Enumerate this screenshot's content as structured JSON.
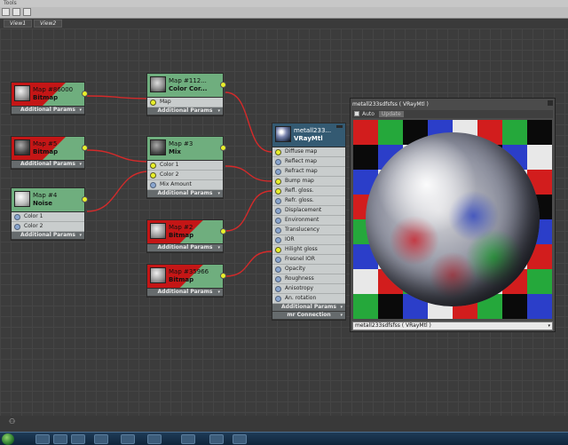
{
  "window": {
    "title": "Tools"
  },
  "tabs": [
    {
      "label": "View1"
    },
    {
      "label": "View2"
    }
  ],
  "nodes": {
    "bitmap1": {
      "title": "Map #86000",
      "subtitle": "Bitmap",
      "additional": "Additional Params"
    },
    "bitmap2": {
      "title": "Map #5",
      "subtitle": "Bitmap",
      "additional": "Additional Params"
    },
    "noise": {
      "title": "Map #4",
      "subtitle": "Noise",
      "ports": [
        "Color 1",
        "Color 2"
      ],
      "additional": "Additional Params"
    },
    "colorcorrect": {
      "title": "Map #112...",
      "subtitle": "Color Cor...",
      "ports": [
        "Map"
      ],
      "additional": "Additional Params"
    },
    "mix": {
      "title": "Map #3",
      "subtitle": "Mix",
      "ports": [
        "Color 1",
        "Color 2",
        "Mix Amount"
      ],
      "additional": "Additional Params"
    },
    "bitmap3": {
      "title": "Map #2",
      "subtitle": "Bitmap",
      "additional": "Additional Params"
    },
    "bitmap4": {
      "title": "Map #35966",
      "subtitle": "Bitmap",
      "additional": "Additional Params"
    },
    "material": {
      "title": "metall233...",
      "subtitle": "VRayMtl",
      "ports": [
        "Diffuse map",
        "Reflect map",
        "Refract map",
        "Bump map",
        "Refl. gloss.",
        "Refr. gloss.",
        "Displacement",
        "Environment",
        "Translucency",
        "IOR",
        "Hilight gloss",
        "Fresnel IOR",
        "Opacity",
        "Roughness",
        "Anisotropy",
        "An. rotation"
      ],
      "connected": [
        true,
        false,
        false,
        true,
        true,
        false,
        false,
        false,
        false,
        false,
        true,
        false,
        false,
        false,
        false,
        false
      ],
      "additional": "Additional Params",
      "connection": "mr Connection"
    }
  },
  "preview": {
    "title": "metall233sdfsfss  ( VRayMtl )",
    "auto_label": "Auto",
    "update_label": "Update",
    "footer": "metall233sdfsfss  ( VRayMtl )"
  },
  "colors": {
    "node_green": "#6fae7e",
    "bitmap_red": "#c41616",
    "vray_blue": "#345a72",
    "port_yellow": "#e8ef2a",
    "wire_red": "#d42a2a"
  }
}
